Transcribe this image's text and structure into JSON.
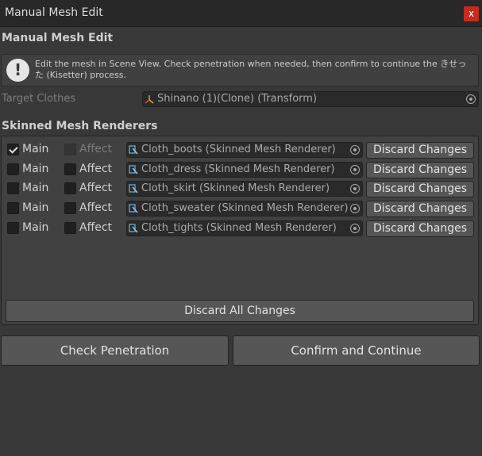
{
  "window": {
    "title": "Manual Mesh Edit",
    "close_label": "x"
  },
  "header": {
    "title": "Manual Mesh Edit"
  },
  "help": {
    "icon": "exclamation-icon",
    "text": "Edit the mesh in Scene View. Check penetration when needed, then confirm to continue the きせった (Kisetter) process."
  },
  "target_clothes": {
    "label": "Target Clothes",
    "value": "Shinano (1)(Clone) (Transform)",
    "icon": "transform-icon"
  },
  "renderers": {
    "title": "Skinned Mesh Renderers",
    "main_label": "Main",
    "affect_label": "Affect",
    "discard_label": "Discard Changes",
    "rows": [
      {
        "main": true,
        "affect": false,
        "affect_disabled": true,
        "object": "Cloth_boots (Skinned Mesh Renderer)"
      },
      {
        "main": false,
        "affect": false,
        "affect_disabled": false,
        "object": "Cloth_dress (Skinned Mesh Renderer)"
      },
      {
        "main": false,
        "affect": false,
        "affect_disabled": false,
        "object": "Cloth_skirt (Skinned Mesh Renderer)"
      },
      {
        "main": false,
        "affect": false,
        "affect_disabled": false,
        "object": "Cloth_sweater (Skinned Mesh Renderer)"
      },
      {
        "main": false,
        "affect": false,
        "affect_disabled": false,
        "object": "Cloth_tights (Skinned Mesh Renderer)"
      }
    ],
    "discard_all_label": "Discard All Changes"
  },
  "actions": {
    "check_label": "Check Penetration",
    "confirm_label": "Confirm and Continue"
  }
}
